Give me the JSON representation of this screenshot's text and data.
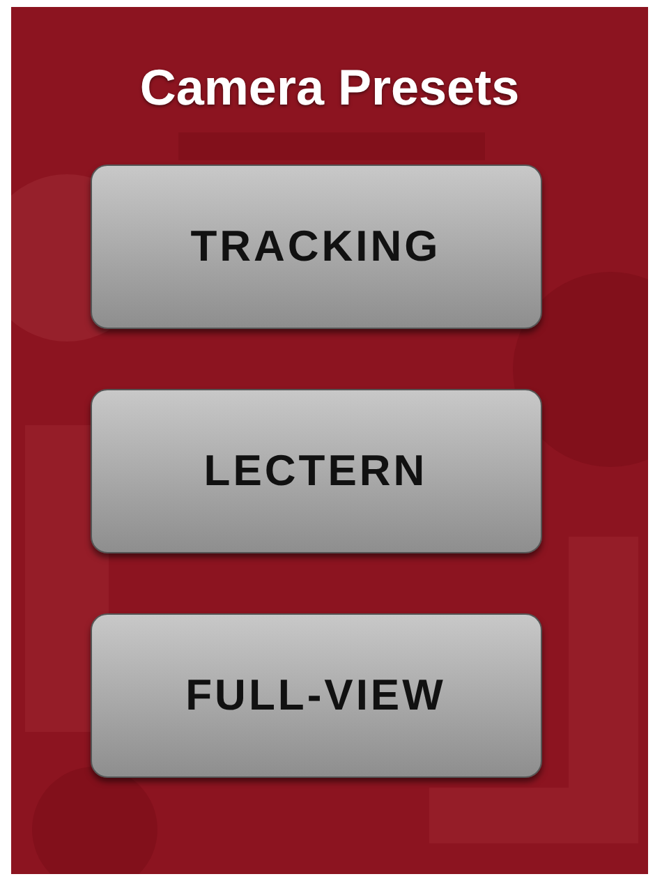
{
  "title": "Camera Presets",
  "buttons": [
    {
      "label": "TRACKING"
    },
    {
      "label": "LECTERN"
    },
    {
      "label": "FULL-VIEW"
    }
  ]
}
